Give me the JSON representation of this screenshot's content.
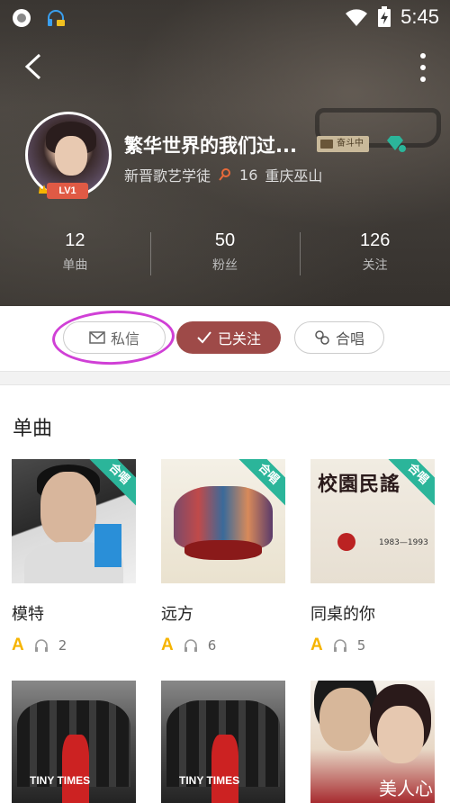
{
  "status": {
    "time": "5:45"
  },
  "profile": {
    "name": "繁华世界的我们过...",
    "tag": "奋斗中",
    "level": "LV1",
    "title": "新晋歌艺学徒",
    "points": "16",
    "location": "重庆巫山"
  },
  "stats": [
    {
      "value": "12",
      "label": "单曲"
    },
    {
      "value": "50",
      "label": "粉丝"
    },
    {
      "value": "126",
      "label": "关注"
    }
  ],
  "actions": {
    "message": "私信",
    "followed": "已关注",
    "duet": "合唱"
  },
  "section": {
    "title": "单曲"
  },
  "songs": [
    {
      "title": "模特",
      "badge": "合唱",
      "listens": "2"
    },
    {
      "title": "远方",
      "badge": "合唱",
      "listens": "6"
    },
    {
      "title": "同桌的你",
      "badge": "合唱",
      "listens": "5",
      "cover_title": "校園民謠",
      "cover_years": "1983—1993"
    },
    {
      "cover_label": "TINY TIMES"
    },
    {
      "cover_label": "TINY TIMES"
    },
    {
      "cover_text": "美人心计"
    }
  ],
  "colors": {
    "accent": "#9e4a48",
    "corner": "#2bb59a",
    "grade": "#f6b400",
    "highlight": "#d040d6"
  }
}
